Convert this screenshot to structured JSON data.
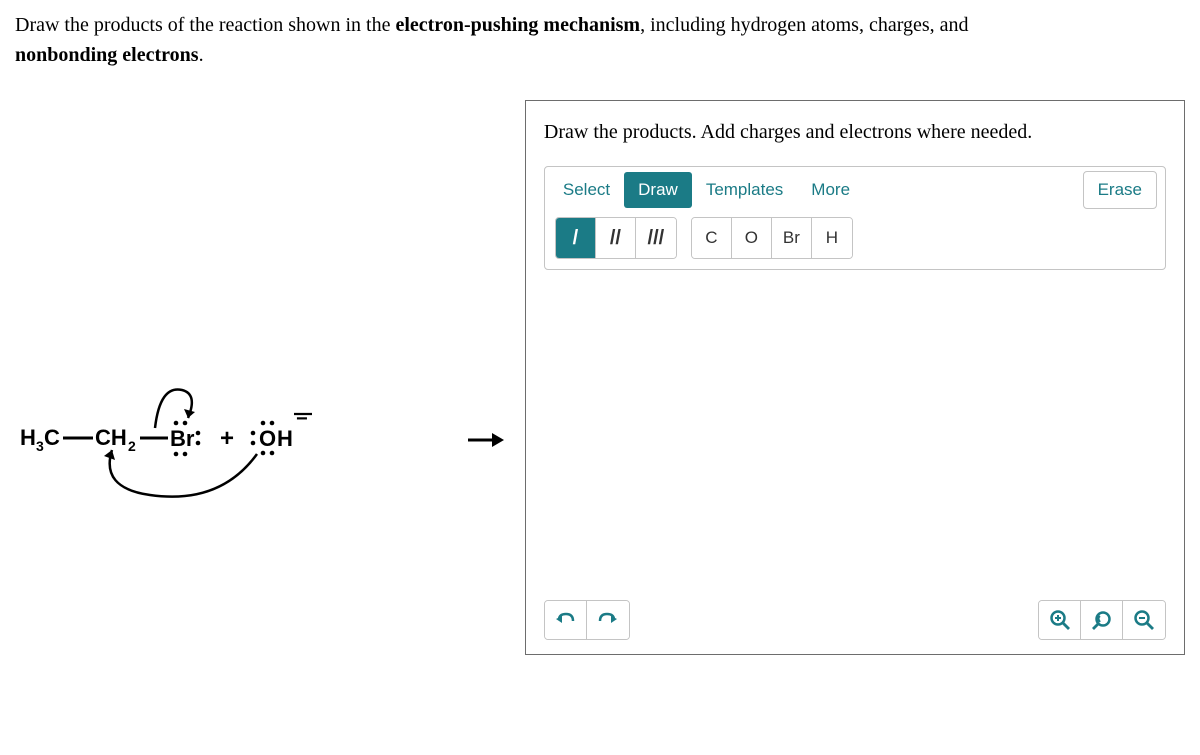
{
  "question": {
    "part1": "Draw the products of the reaction shown in the ",
    "bold1": "electron-pushing mechanism",
    "part2": ", including hydrogen atoms, charges, and ",
    "bold2": "nonbonding electrons",
    "part3": "."
  },
  "mechanism": {
    "reactant_left": "H₃C—CH₂—Br:",
    "plus": "+",
    "reactant_right": ":OH⁻"
  },
  "editor": {
    "instruction": "Draw the products. Add charges and electrons where needed.",
    "tabs": {
      "select": "Select",
      "draw": "Draw",
      "templates": "Templates",
      "more": "More"
    },
    "erase": "Erase",
    "bonds": {
      "single": "/",
      "double": "//",
      "triple": "///"
    },
    "atoms": {
      "c": "C",
      "o": "O",
      "br": "Br",
      "h": "H"
    }
  }
}
